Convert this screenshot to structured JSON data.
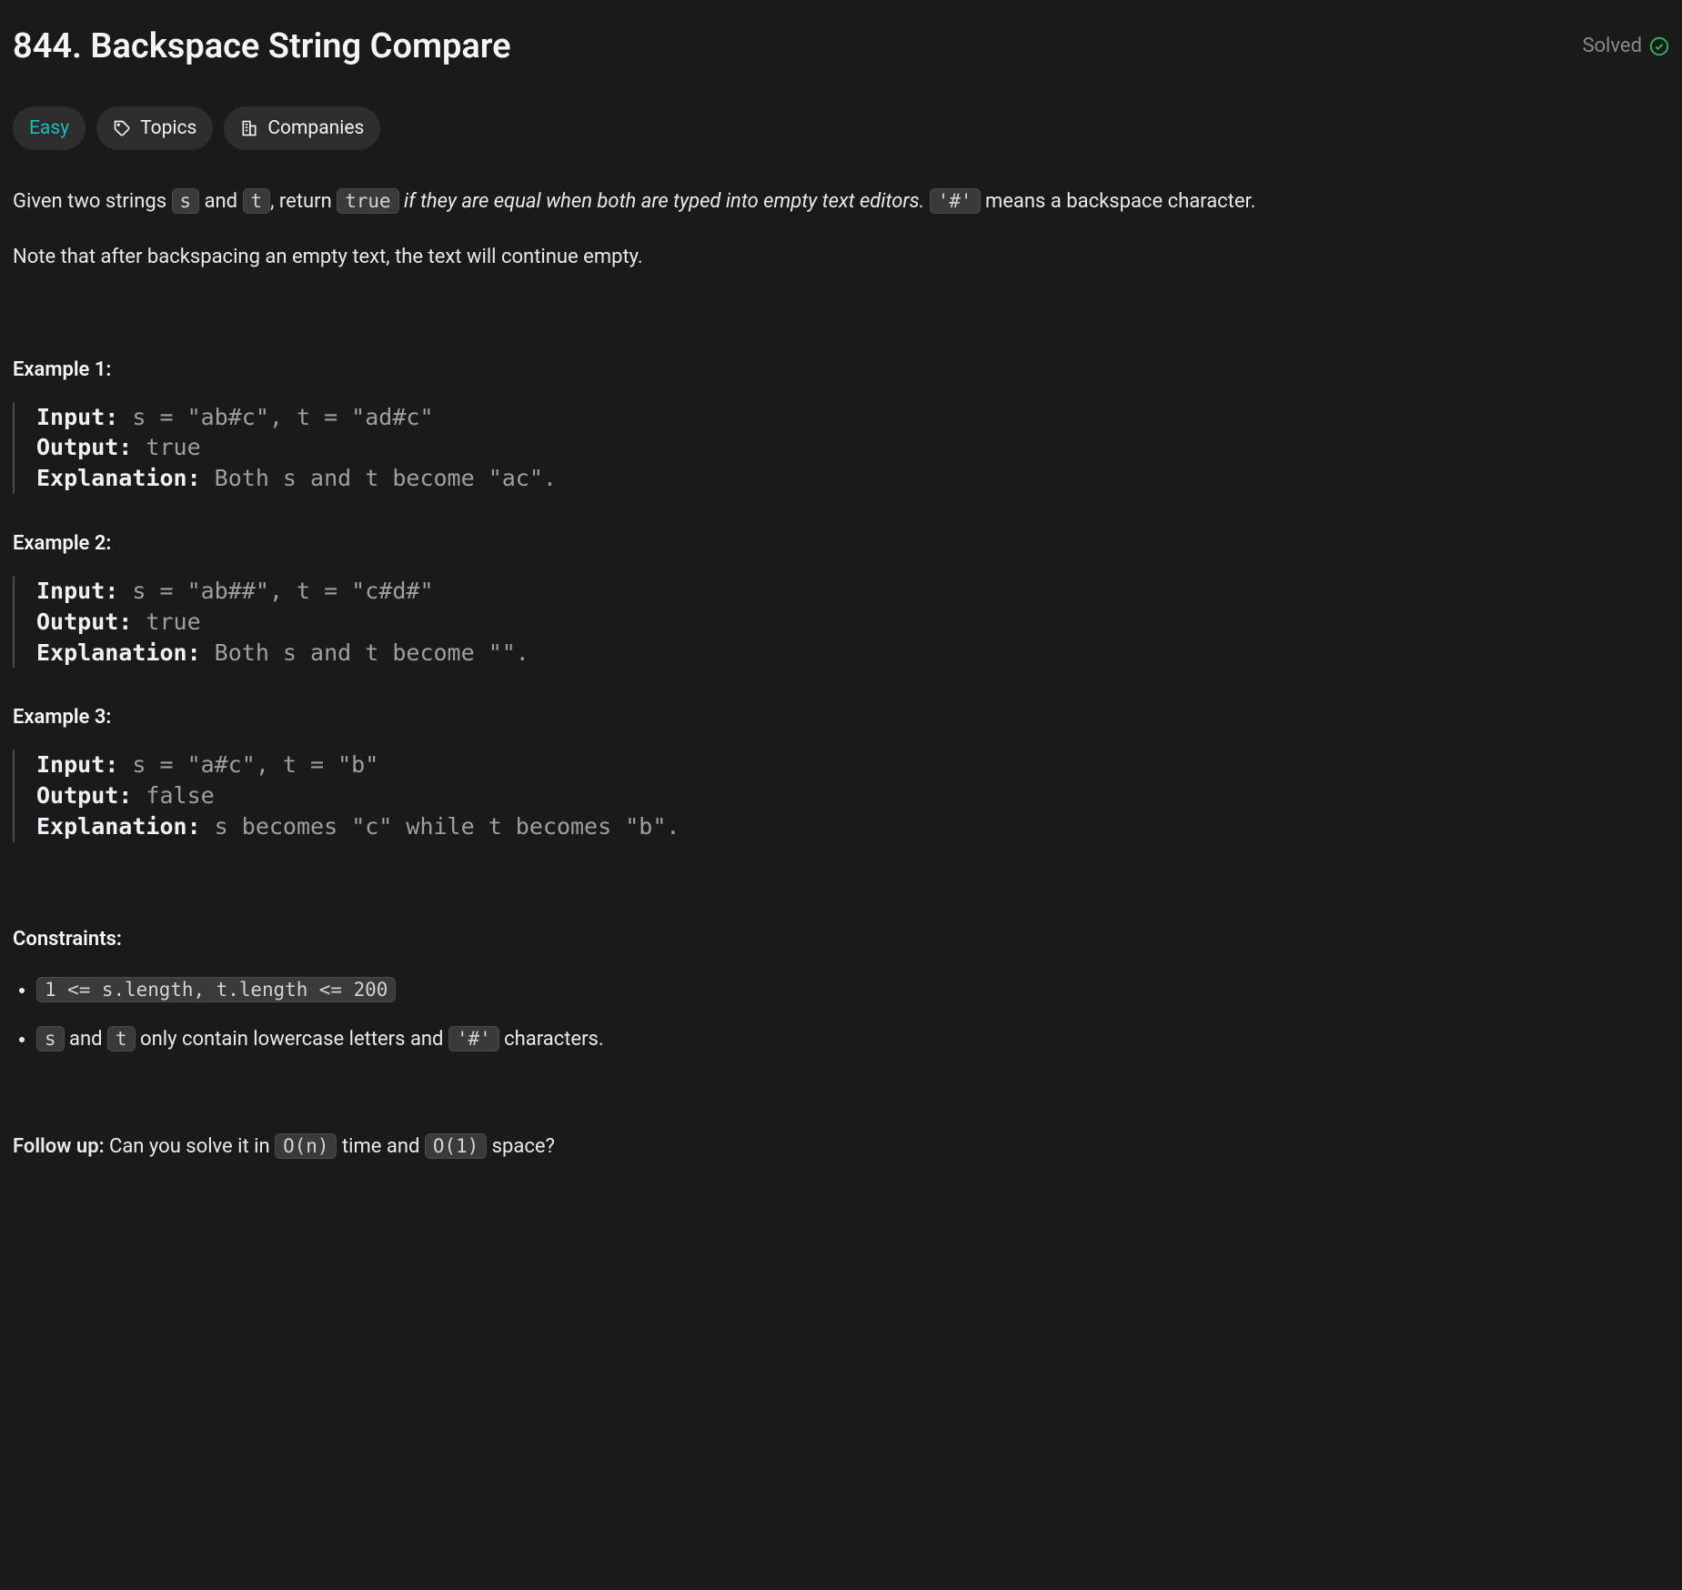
{
  "header": {
    "title": "844. Backspace String Compare",
    "status": "Solved"
  },
  "chips": {
    "difficulty": "Easy",
    "topics": "Topics",
    "companies": "Companies"
  },
  "desc": {
    "t1": "Given two strings ",
    "s": "s",
    "t2": " and ",
    "t": "t",
    "t3": ", return ",
    "true": "true",
    "t4": " if they are equal when both are typed into empty text editors.",
    "t5": " ",
    "hash": "'#'",
    "t6": " means a backspace character.",
    "note": "Note that after backspacing an empty text, the text will continue empty."
  },
  "examples": [
    {
      "label": "Example 1:",
      "input": " s = \"ab#c\", t = \"ad#c\"",
      "output": " true",
      "explanation": " Both s and t become \"ac\"."
    },
    {
      "label": "Example 2:",
      "input": " s = \"ab##\", t = \"c#d#\"",
      "output": " true",
      "explanation": " Both s and t become \"\"."
    },
    {
      "label": "Example 3:",
      "input": " s = \"a#c\", t = \"b\"",
      "output": " false",
      "explanation": " s becomes \"c\" while t becomes \"b\"."
    }
  ],
  "labels": {
    "input": "Input:",
    "output": "Output:",
    "explanation": "Explanation:",
    "constraints": "Constraints:",
    "followup": "Follow up:"
  },
  "constraints": {
    "c1": "1 <= s.length, t.length <= 200",
    "c2a": "s",
    "c2b": " and ",
    "c2c": "t",
    "c2d": " only contain lowercase letters and ",
    "c2e": "'#'",
    "c2f": " characters."
  },
  "followup": {
    "t1": " Can you solve it in ",
    "on": "O(n)",
    "t2": " time and ",
    "o1": "O(1)",
    "t3": " space?"
  }
}
